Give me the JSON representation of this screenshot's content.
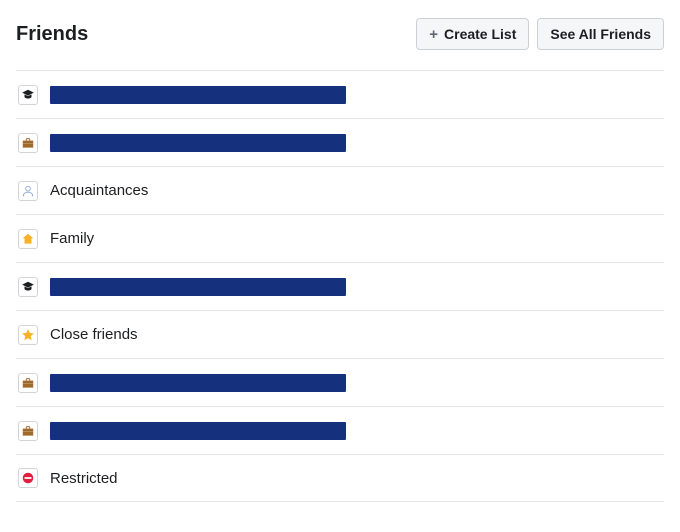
{
  "header": {
    "title": "Friends",
    "create_list_label": "Create List",
    "see_all_label": "See All Friends"
  },
  "rows": [
    {
      "icon": "education-icon",
      "redacted": true,
      "label": "",
      "redact_width": 296
    },
    {
      "icon": "work-icon",
      "redacted": true,
      "label": "",
      "redact_width": 296
    },
    {
      "icon": "person-icon",
      "redacted": false,
      "label": "Acquaintances",
      "redact_width": 0
    },
    {
      "icon": "home-icon",
      "redacted": false,
      "label": "Family",
      "redact_width": 0
    },
    {
      "icon": "education-icon",
      "redacted": true,
      "label": "",
      "redact_width": 296
    },
    {
      "icon": "star-icon",
      "redacted": false,
      "label": "Close friends",
      "redact_width": 0
    },
    {
      "icon": "work-icon",
      "redacted": true,
      "label": "",
      "redact_width": 296
    },
    {
      "icon": "work-icon",
      "redacted": true,
      "label": "",
      "redact_width": 296
    },
    {
      "icon": "restricted-icon",
      "redacted": false,
      "label": "Restricted",
      "redact_width": 0
    }
  ],
  "icon_colors": {
    "education-icon": "#1c1e21",
    "work-icon": "#a06b2a",
    "person-icon": "#8aa9d6",
    "home-icon": "#f7b228",
    "star-icon": "#f7b228",
    "restricted-icon": "#e41e3f"
  }
}
